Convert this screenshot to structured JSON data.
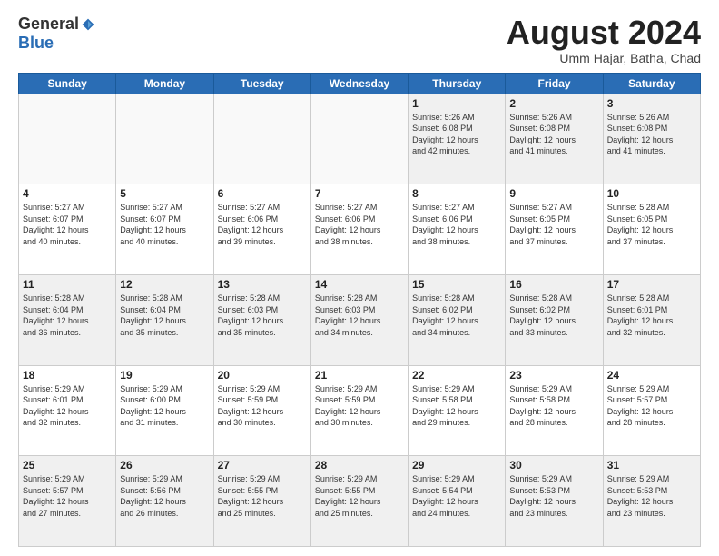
{
  "logo": {
    "general": "General",
    "blue": "Blue"
  },
  "header": {
    "month": "August 2024",
    "location": "Umm Hajar, Batha, Chad"
  },
  "weekdays": [
    "Sunday",
    "Monday",
    "Tuesday",
    "Wednesday",
    "Thursday",
    "Friday",
    "Saturday"
  ],
  "weeks": [
    [
      {
        "day": "",
        "info": ""
      },
      {
        "day": "",
        "info": ""
      },
      {
        "day": "",
        "info": ""
      },
      {
        "day": "",
        "info": ""
      },
      {
        "day": "1",
        "info": "Sunrise: 5:26 AM\nSunset: 6:08 PM\nDaylight: 12 hours\nand 42 minutes."
      },
      {
        "day": "2",
        "info": "Sunrise: 5:26 AM\nSunset: 6:08 PM\nDaylight: 12 hours\nand 41 minutes."
      },
      {
        "day": "3",
        "info": "Sunrise: 5:26 AM\nSunset: 6:08 PM\nDaylight: 12 hours\nand 41 minutes."
      }
    ],
    [
      {
        "day": "4",
        "info": "Sunrise: 5:27 AM\nSunset: 6:07 PM\nDaylight: 12 hours\nand 40 minutes."
      },
      {
        "day": "5",
        "info": "Sunrise: 5:27 AM\nSunset: 6:07 PM\nDaylight: 12 hours\nand 40 minutes."
      },
      {
        "day": "6",
        "info": "Sunrise: 5:27 AM\nSunset: 6:06 PM\nDaylight: 12 hours\nand 39 minutes."
      },
      {
        "day": "7",
        "info": "Sunrise: 5:27 AM\nSunset: 6:06 PM\nDaylight: 12 hours\nand 38 minutes."
      },
      {
        "day": "8",
        "info": "Sunrise: 5:27 AM\nSunset: 6:06 PM\nDaylight: 12 hours\nand 38 minutes."
      },
      {
        "day": "9",
        "info": "Sunrise: 5:27 AM\nSunset: 6:05 PM\nDaylight: 12 hours\nand 37 minutes."
      },
      {
        "day": "10",
        "info": "Sunrise: 5:28 AM\nSunset: 6:05 PM\nDaylight: 12 hours\nand 37 minutes."
      }
    ],
    [
      {
        "day": "11",
        "info": "Sunrise: 5:28 AM\nSunset: 6:04 PM\nDaylight: 12 hours\nand 36 minutes."
      },
      {
        "day": "12",
        "info": "Sunrise: 5:28 AM\nSunset: 6:04 PM\nDaylight: 12 hours\nand 35 minutes."
      },
      {
        "day": "13",
        "info": "Sunrise: 5:28 AM\nSunset: 6:03 PM\nDaylight: 12 hours\nand 35 minutes."
      },
      {
        "day": "14",
        "info": "Sunrise: 5:28 AM\nSunset: 6:03 PM\nDaylight: 12 hours\nand 34 minutes."
      },
      {
        "day": "15",
        "info": "Sunrise: 5:28 AM\nSunset: 6:02 PM\nDaylight: 12 hours\nand 34 minutes."
      },
      {
        "day": "16",
        "info": "Sunrise: 5:28 AM\nSunset: 6:02 PM\nDaylight: 12 hours\nand 33 minutes."
      },
      {
        "day": "17",
        "info": "Sunrise: 5:28 AM\nSunset: 6:01 PM\nDaylight: 12 hours\nand 32 minutes."
      }
    ],
    [
      {
        "day": "18",
        "info": "Sunrise: 5:29 AM\nSunset: 6:01 PM\nDaylight: 12 hours\nand 32 minutes."
      },
      {
        "day": "19",
        "info": "Sunrise: 5:29 AM\nSunset: 6:00 PM\nDaylight: 12 hours\nand 31 minutes."
      },
      {
        "day": "20",
        "info": "Sunrise: 5:29 AM\nSunset: 5:59 PM\nDaylight: 12 hours\nand 30 minutes."
      },
      {
        "day": "21",
        "info": "Sunrise: 5:29 AM\nSunset: 5:59 PM\nDaylight: 12 hours\nand 30 minutes."
      },
      {
        "day": "22",
        "info": "Sunrise: 5:29 AM\nSunset: 5:58 PM\nDaylight: 12 hours\nand 29 minutes."
      },
      {
        "day": "23",
        "info": "Sunrise: 5:29 AM\nSunset: 5:58 PM\nDaylight: 12 hours\nand 28 minutes."
      },
      {
        "day": "24",
        "info": "Sunrise: 5:29 AM\nSunset: 5:57 PM\nDaylight: 12 hours\nand 28 minutes."
      }
    ],
    [
      {
        "day": "25",
        "info": "Sunrise: 5:29 AM\nSunset: 5:57 PM\nDaylight: 12 hours\nand 27 minutes."
      },
      {
        "day": "26",
        "info": "Sunrise: 5:29 AM\nSunset: 5:56 PM\nDaylight: 12 hours\nand 26 minutes."
      },
      {
        "day": "27",
        "info": "Sunrise: 5:29 AM\nSunset: 5:55 PM\nDaylight: 12 hours\nand 25 minutes."
      },
      {
        "day": "28",
        "info": "Sunrise: 5:29 AM\nSunset: 5:55 PM\nDaylight: 12 hours\nand 25 minutes."
      },
      {
        "day": "29",
        "info": "Sunrise: 5:29 AM\nSunset: 5:54 PM\nDaylight: 12 hours\nand 24 minutes."
      },
      {
        "day": "30",
        "info": "Sunrise: 5:29 AM\nSunset: 5:53 PM\nDaylight: 12 hours\nand 23 minutes."
      },
      {
        "day": "31",
        "info": "Sunrise: 5:29 AM\nSunset: 5:53 PM\nDaylight: 12 hours\nand 23 minutes."
      }
    ]
  ]
}
